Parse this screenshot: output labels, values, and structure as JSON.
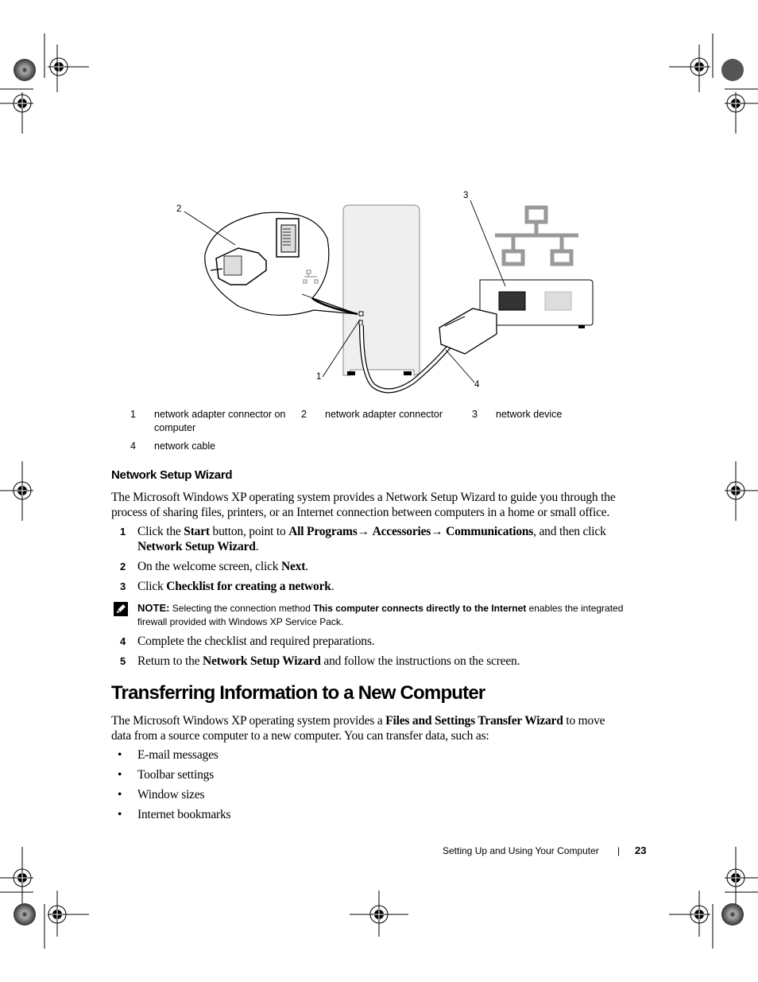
{
  "figure": {
    "callout_numbers": [
      "1",
      "2",
      "3",
      "4"
    ],
    "legend": [
      {
        "num": "1",
        "label": "network adapter connector on",
        "label_cont": "computer"
      },
      {
        "num": "2",
        "label": "network adapter connector"
      },
      {
        "num": "3",
        "label": "network device"
      },
      {
        "num": "4",
        "label": "network cable"
      }
    ]
  },
  "section1": {
    "heading": "Network Setup Wizard",
    "intro_line1": "The Microsoft Windows XP operating system provides a Network Setup Wizard to guide you through the",
    "intro_line2": "process of sharing files, printers, or an Internet connection between computers in a home or small office.",
    "steps": [
      {
        "num": "1",
        "parts": [
          "Click the ",
          "Start",
          " button, point to ",
          "All Programs",
          "→ ",
          "Accessories",
          "→ ",
          "Communications",
          ", and then click"
        ],
        "line2_bold": "Network Setup Wizard",
        "line2_rest": "."
      },
      {
        "num": "2",
        "pre": "On the welcome screen, click ",
        "bold": "Next",
        "post": "."
      },
      {
        "num": "3",
        "pre": "Click ",
        "bold": "Checklist for creating a network",
        "post": "."
      },
      {
        "num": "4",
        "text": "Complete the checklist and required preparations."
      },
      {
        "num": "5",
        "pre": "Return to the ",
        "bold": "Network Setup Wizard",
        "post": " and follow the instructions on the screen."
      }
    ],
    "note": {
      "label": "NOTE:",
      "pre": " Selecting the connection method ",
      "bold": "This computer connects directly to the Internet",
      "post": " enables the integrated",
      "line2": "firewall provided with Windows XP Service Pack."
    }
  },
  "section2": {
    "heading": "Transferring Information to a New Computer",
    "intro_pre": "The Microsoft Windows XP operating system provides a ",
    "intro_bold": "Files and Settings Transfer Wizard",
    "intro_post": " to move",
    "intro_line2": "data from a source computer to a new computer. You can transfer data, such as:",
    "bullets": [
      "E-mail messages",
      "Toolbar settings",
      "Window sizes",
      "Internet bookmarks"
    ]
  },
  "footer": {
    "chapter": "Setting Up and Using Your Computer",
    "separator": "|",
    "page_number": "23"
  }
}
